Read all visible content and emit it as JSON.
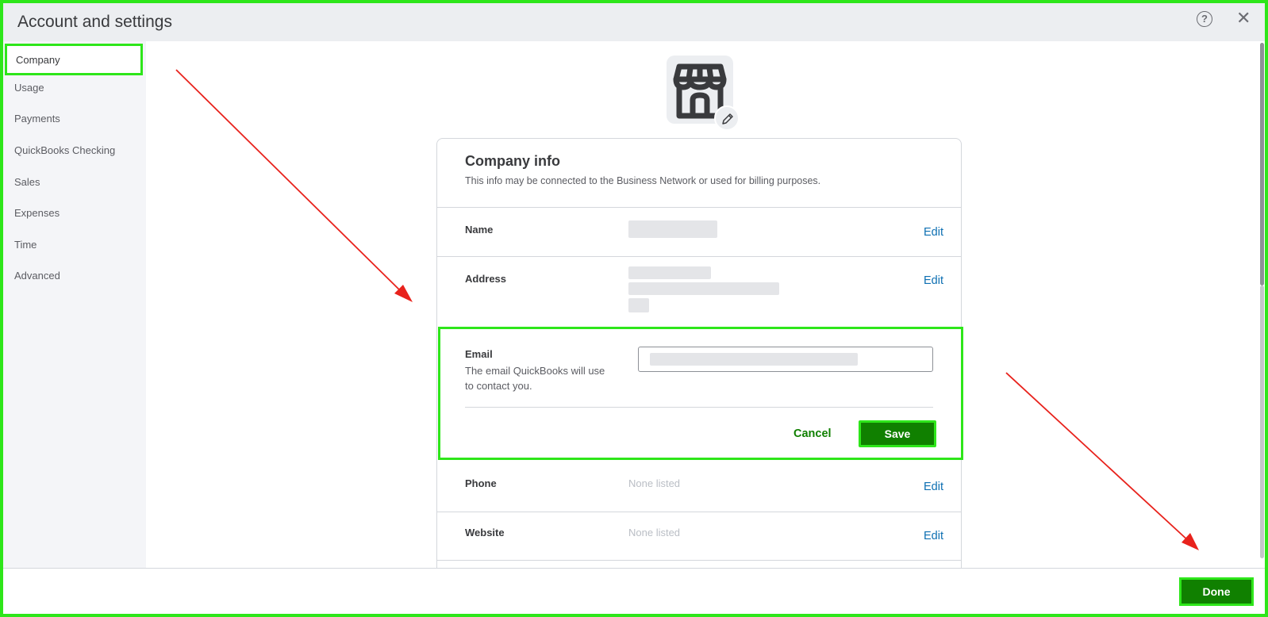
{
  "header": {
    "title": "Account and settings",
    "help_icon": "question-circle-icon",
    "help_glyph": "?",
    "close_icon": "close-icon",
    "close_glyph": "✕"
  },
  "sidebar": {
    "items": [
      {
        "label": "Company",
        "active": true
      },
      {
        "label": "Usage"
      },
      {
        "label": "Payments"
      },
      {
        "label": "QuickBooks Checking"
      },
      {
        "label": "Sales"
      },
      {
        "label": "Expenses"
      },
      {
        "label": "Time"
      },
      {
        "label": "Advanced"
      }
    ]
  },
  "company_logo": {
    "icon": "storefront-icon",
    "edit_icon": "pencil-icon"
  },
  "company_info": {
    "title": "Company info",
    "subtitle": "This info may be connected to the Business Network or used for billing purposes.",
    "rows": {
      "name": {
        "label": "Name",
        "edit": "Edit"
      },
      "address": {
        "label": "Address",
        "edit": "Edit"
      },
      "email": {
        "label": "Email",
        "help": "The email QuickBooks will use to contact you."
      },
      "phone": {
        "label": "Phone",
        "value": "None listed",
        "edit": "Edit"
      },
      "website": {
        "label": "Website",
        "value": "None listed",
        "edit": "Edit"
      }
    }
  },
  "email_actions": {
    "cancel": "Cancel",
    "save": "Save"
  },
  "footer": {
    "done": "Done"
  },
  "colors": {
    "highlight": "#2ee61a",
    "primary_green": "#108000",
    "link_blue": "#0d6fb2",
    "annotation_red": "#e8221c"
  }
}
